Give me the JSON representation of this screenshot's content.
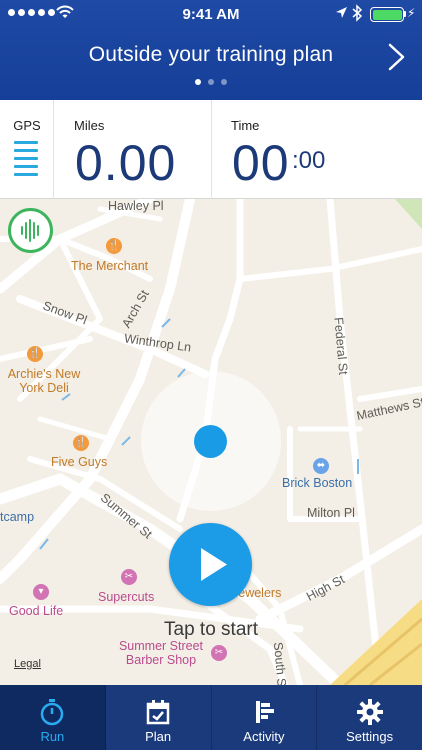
{
  "status_bar": {
    "time": "9:41 AM"
  },
  "header": {
    "title": "Outside your training plan",
    "page_dots": 3,
    "active_dot": 0
  },
  "stats": {
    "gps_label": "GPS",
    "miles_label": "Miles",
    "miles_value": "0.00",
    "time_label": "Time",
    "time_minutes": "00",
    "time_seconds": ":00"
  },
  "map": {
    "streets": [
      "Hawley Pl",
      "Arch St",
      "Snow Pl",
      "Winthrop Ln",
      "Federal St",
      "Matthews St",
      "Summer St",
      "Milton Pl",
      "High St",
      "South St"
    ],
    "places": [
      "The Merchant",
      "Archie's New York Deli",
      "Five Guys",
      "Brick Boston",
      "Supercuts",
      "Good Life",
      "Summer Street Barber Shop",
      "Jewelers",
      "tcamp"
    ],
    "tap_hint": "Tap to start",
    "legal": "Legal"
  },
  "tabs": [
    {
      "label": "Run",
      "icon": "stopwatch-icon",
      "active": true
    },
    {
      "label": "Plan",
      "icon": "calendar-icon",
      "active": false
    },
    {
      "label": "Activity",
      "icon": "activity-icon",
      "active": false
    },
    {
      "label": "Settings",
      "icon": "gear-icon",
      "active": false
    }
  ],
  "colors": {
    "header_blue": "#1f4aa5",
    "accent_blue": "#1c9be6",
    "tab_bar": "#1a3a7c",
    "tab_active_text": "#2aaaf0",
    "audio_green": "#3cb55e"
  }
}
